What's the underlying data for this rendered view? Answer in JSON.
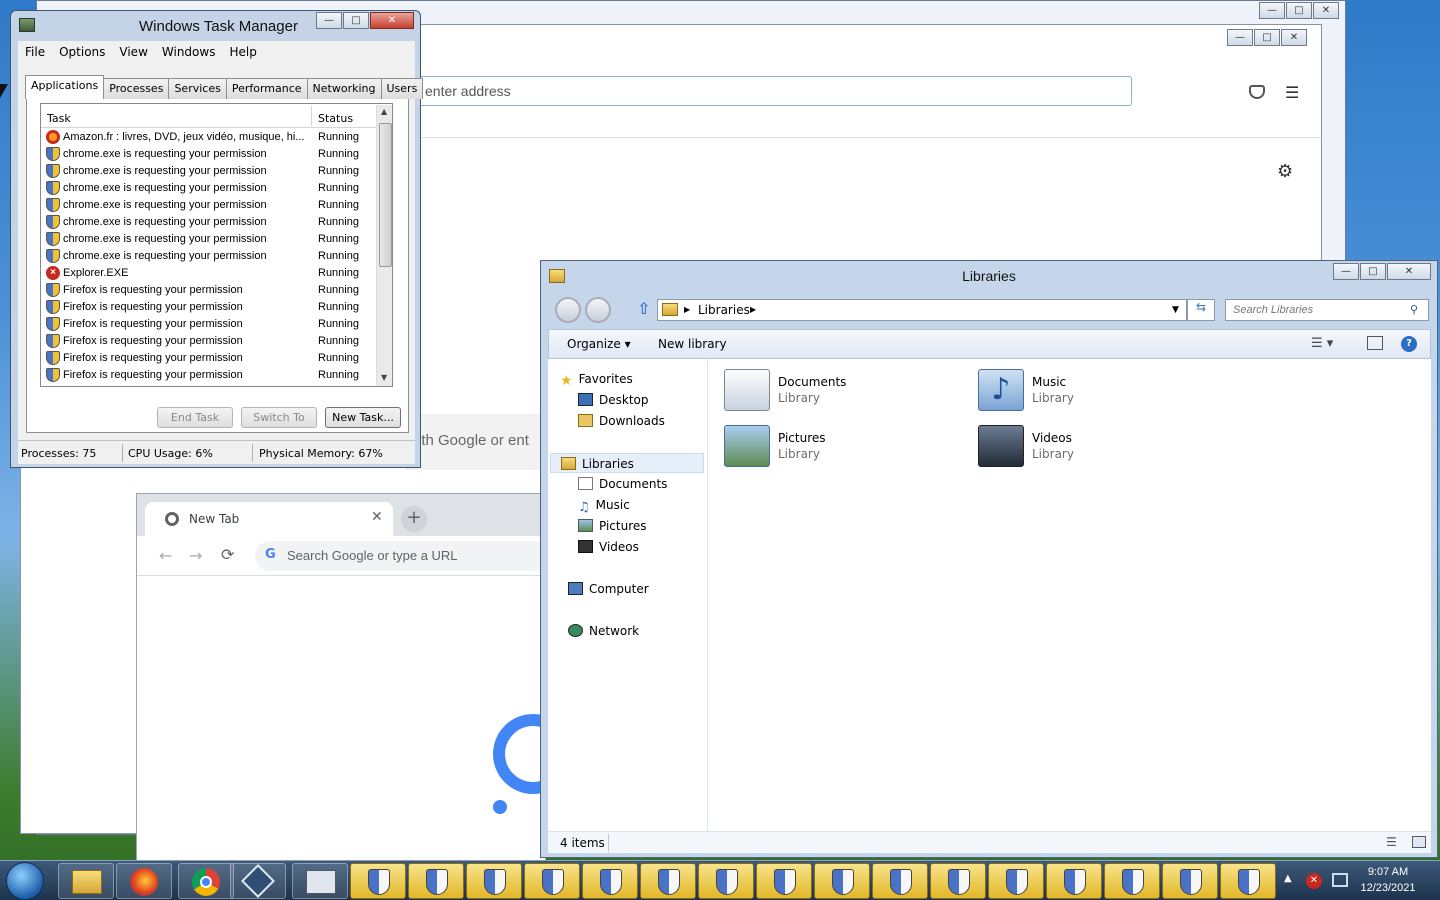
{
  "firefox": {
    "url_placeholder": "enter address",
    "partial_search_text": "ith Google or ent"
  },
  "chrome": {
    "tab_title": "New Tab",
    "omnibox_placeholder": "Search Google or type a URL"
  },
  "task_manager": {
    "title": "Windows Task Manager",
    "menu": [
      "File",
      "Options",
      "View",
      "Windows",
      "Help"
    ],
    "tabs": [
      "Applications",
      "Processes",
      "Services",
      "Performance",
      "Networking",
      "Users"
    ],
    "active_tab": "Applications",
    "columns": {
      "task": "Task",
      "status": "Status"
    },
    "rows": [
      {
        "icon": "amazon",
        "task": "Amazon.fr : livres, DVD, jeux vidéo, musique, hi...",
        "status": "Running"
      },
      {
        "icon": "shield",
        "task": "chrome.exe is requesting your permission",
        "status": "Running"
      },
      {
        "icon": "shield",
        "task": "chrome.exe is requesting your permission",
        "status": "Running"
      },
      {
        "icon": "shield",
        "task": "chrome.exe is requesting your permission",
        "status": "Running"
      },
      {
        "icon": "shield",
        "task": "chrome.exe is requesting your permission",
        "status": "Running"
      },
      {
        "icon": "shield",
        "task": "chrome.exe is requesting your permission",
        "status": "Running"
      },
      {
        "icon": "shield",
        "task": "chrome.exe is requesting your permission",
        "status": "Running"
      },
      {
        "icon": "shield",
        "task": "chrome.exe is requesting your permission",
        "status": "Running"
      },
      {
        "icon": "error",
        "task": "Explorer.EXE",
        "status": "Running"
      },
      {
        "icon": "shield",
        "task": "Firefox is requesting your permission",
        "status": "Running"
      },
      {
        "icon": "shield",
        "task": "Firefox is requesting your permission",
        "status": "Running"
      },
      {
        "icon": "shield",
        "task": "Firefox is requesting your permission",
        "status": "Running"
      },
      {
        "icon": "shield",
        "task": "Firefox is requesting your permission",
        "status": "Running"
      },
      {
        "icon": "shield",
        "task": "Firefox is requesting your permission",
        "status": "Running"
      },
      {
        "icon": "shield",
        "task": "Firefox is requesting your permission",
        "status": "Running"
      }
    ],
    "buttons": {
      "end_task": "End Task",
      "switch_to": "Switch To",
      "new_task": "New Task..."
    },
    "status": {
      "processes": "Processes: 75",
      "cpu": "CPU Usage: 6%",
      "memory": "Physical Memory: 67%"
    }
  },
  "explorer": {
    "title": "Libraries",
    "breadcrumb": "Libraries",
    "search_placeholder": "Search Libraries",
    "commands": {
      "organize": "Organize",
      "new_library": "New library"
    },
    "nav": {
      "favorites": "Favorites",
      "desktop": "Desktop",
      "downloads": "Downloads",
      "libraries": "Libraries",
      "documents": "Documents",
      "music": "Music",
      "pictures": "Pictures",
      "videos": "Videos",
      "computer": "Computer",
      "network": "Network"
    },
    "items": [
      {
        "name": "Documents",
        "type": "Library"
      },
      {
        "name": "Music",
        "type": "Library"
      },
      {
        "name": "Pictures",
        "type": "Library"
      },
      {
        "name": "Videos",
        "type": "Library"
      }
    ],
    "status": "4 items"
  },
  "taskbar": {
    "time": "9:07 AM",
    "date": "12/23/2021"
  }
}
